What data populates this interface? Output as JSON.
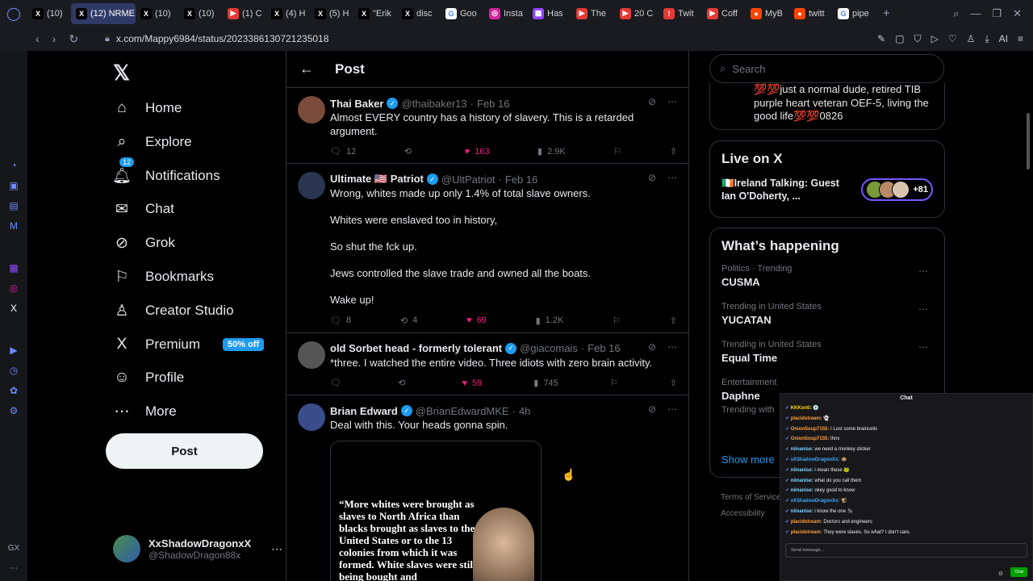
{
  "browser": {
    "tabs": [
      {
        "label": "(10)",
        "icon": "x",
        "color": "#000"
      },
      {
        "label": "(12) NRME",
        "icon": "x",
        "color": "#000",
        "active": true
      },
      {
        "label": "(10)",
        "icon": "x",
        "color": "#000"
      },
      {
        "label": "(10)",
        "icon": "x",
        "color": "#000"
      },
      {
        "label": "(1) C",
        "icon": "yt",
        "color": "#e53935"
      },
      {
        "label": "(4) H",
        "icon": "x",
        "color": "#000"
      },
      {
        "label": "(5) H",
        "icon": "x",
        "color": "#000"
      },
      {
        "label": "\"Erik",
        "icon": "x",
        "color": "#000"
      },
      {
        "label": "disc",
        "icon": "x",
        "color": "#000"
      },
      {
        "label": "Goo",
        "icon": "g",
        "color": "#ffffff"
      },
      {
        "label": "Insta",
        "icon": "ig",
        "color": "#d6249f"
      },
      {
        "label": "Has",
        "icon": "tw",
        "color": "#9146ff"
      },
      {
        "label": "The",
        "icon": "yt",
        "color": "#e53935"
      },
      {
        "label": "20 C",
        "icon": "yt",
        "color": "#e53935"
      },
      {
        "label": "Twit",
        "icon": "!",
        "color": "#e53935"
      },
      {
        "label": "Coff",
        "icon": "yt",
        "color": "#e53935"
      },
      {
        "label": "MyB",
        "icon": "rd",
        "color": "#ff4500"
      },
      {
        "label": "twitt",
        "icon": "rd",
        "color": "#ff4500"
      },
      {
        "label": "pipe",
        "icon": "g",
        "color": "#ffffff"
      }
    ],
    "new_tab": "+",
    "url": "x.com/Mappy6984/status/2023386130721235018",
    "ai_label": "AI"
  },
  "nav": {
    "items": [
      {
        "key": "home",
        "label": "Home",
        "icon": "⌂"
      },
      {
        "key": "explore",
        "label": "Explore",
        "icon": "⌕"
      },
      {
        "key": "notifications",
        "label": "Notifications",
        "icon": "🔔︎",
        "badge": "12"
      },
      {
        "key": "chat",
        "label": "Chat",
        "icon": "✉"
      },
      {
        "key": "grok",
        "label": "Grok",
        "icon": "⊘"
      },
      {
        "key": "bookmarks",
        "label": "Bookmarks",
        "icon": "⚐"
      },
      {
        "key": "creator",
        "label": "Creator Studio",
        "icon": "♙"
      },
      {
        "key": "premium",
        "label": "Premium",
        "icon": "X",
        "promo": "50% off"
      },
      {
        "key": "profile",
        "label": "Profile",
        "icon": "☺"
      },
      {
        "key": "more",
        "label": "More",
        "icon": "⋯"
      }
    ],
    "post_label": "Post",
    "account": {
      "name": "XxShadowDragonxX",
      "handle": "@ShadowDragon88x"
    }
  },
  "main": {
    "title": "Post",
    "tweets": [
      {
        "name": "Thai Baker",
        "handle": "@thaibaker13",
        "date": "Feb 16",
        "text": "Almost EVERY country has a history of slavery. This is a retarded argument.",
        "replies": "12",
        "reposts": "",
        "likes": "163",
        "views": "2.9K",
        "avatar_color": "#7a4a3a"
      },
      {
        "name": "Ultimate 🇺🇸 Patriot",
        "handle": "@UltPatriot",
        "date": "Feb 16",
        "text": "Wrong, whites made up only 1.4% of total slave owners.\n\nWhites were enslaved too in history,\n\nSo shut the fck up.\n\nJews controlled the slave trade and owned all the boats.\n\nWake up!",
        "replies": "8",
        "reposts": "4",
        "likes": "69",
        "views": "1.2K",
        "avatar_color": "#2a3550"
      },
      {
        "name": "old Sorbet head - formerly tolerant",
        "handle": "@giacomais",
        "date": "Feb 16",
        "text": "*three. I watched the entire video.   Three idiots with zero brain activity.",
        "replies": "",
        "reposts": "",
        "likes": "59",
        "views": "745",
        "avatar_color": "#555"
      },
      {
        "name": "Brian Edward",
        "handle": "@BrianEdwardMKE",
        "date": "4h",
        "text": "Deal with this.   Your heads gonna spin.",
        "avatar_color": "#3a4c8a",
        "media_quote": "“More whites were brought as slaves to North Africa than blacks brought as slaves to the United States or to the 13 colonies from which it was formed. White slaves were still being bought and"
      }
    ]
  },
  "right": {
    "search_placeholder": "Search",
    "bio_text": "💯💯just a normal dude, retired TIB purple heart veteran OEF-5, living the good life💯💯0826",
    "live_title": "Live on X",
    "live_text": "🇮🇪Ireland Talking: Guest Ian O'Doherty, ...",
    "live_count": "+81",
    "happening_title": "What’s happening",
    "trends": [
      {
        "meta": "Politics · Trending",
        "name": "CUSMA"
      },
      {
        "meta": "Trending in United States",
        "name": "YUCATAN"
      },
      {
        "meta": "Trending in United States",
        "name": "Equal Time"
      },
      {
        "meta": "Entertainment",
        "name": "Daphne",
        "sub": "Trending with"
      }
    ],
    "show_more": "Show more",
    "footer_1": "Terms of Service",
    "footer_2": "Accessibility"
  },
  "chat": {
    "title": "Chat",
    "messages": [
      {
        "user": "KKKonti:",
        "text": "💿",
        "color": "#ffd700"
      },
      {
        "user": "placidstream:",
        "text": "👻",
        "color": "#ff9f3a"
      },
      {
        "user": "OnionSoup7155:",
        "text": "I Lost some braincells",
        "color": "#ff9f3a"
      },
      {
        "user": "OnionSoup7155:",
        "text": "thnx",
        "color": "#ff9f3a"
      },
      {
        "user": "niinanise:",
        "text": "we need a monkey sticker",
        "color": "#7fd6ff"
      },
      {
        "user": "xXShadowDragonXx:",
        "text": "🐵",
        "color": "#3ea6ff"
      },
      {
        "user": "niinanise:",
        "text": "i mean these 🐸",
        "color": "#7fd6ff"
      },
      {
        "user": "niinanise:",
        "text": "what do you call them",
        "color": "#7fd6ff"
      },
      {
        "user": "niinanise:",
        "text": "okey good to know",
        "color": "#7fd6ff"
      },
      {
        "user": "xXShadowDragonXx:",
        "text": "🐒",
        "color": "#3ea6ff"
      },
      {
        "user": "niinanise:",
        "text": "i know the one 🦍",
        "color": "#7fd6ff"
      },
      {
        "user": "placidstream:",
        "text": "Doctors and engineers",
        "color": "#ff9f3a"
      },
      {
        "user": "placidstream:",
        "text": "They were slaves. So what? I don't care.",
        "color": "#ff9f3a"
      }
    ],
    "input_placeholder": "Send message...",
    "send_label": "Chat"
  }
}
